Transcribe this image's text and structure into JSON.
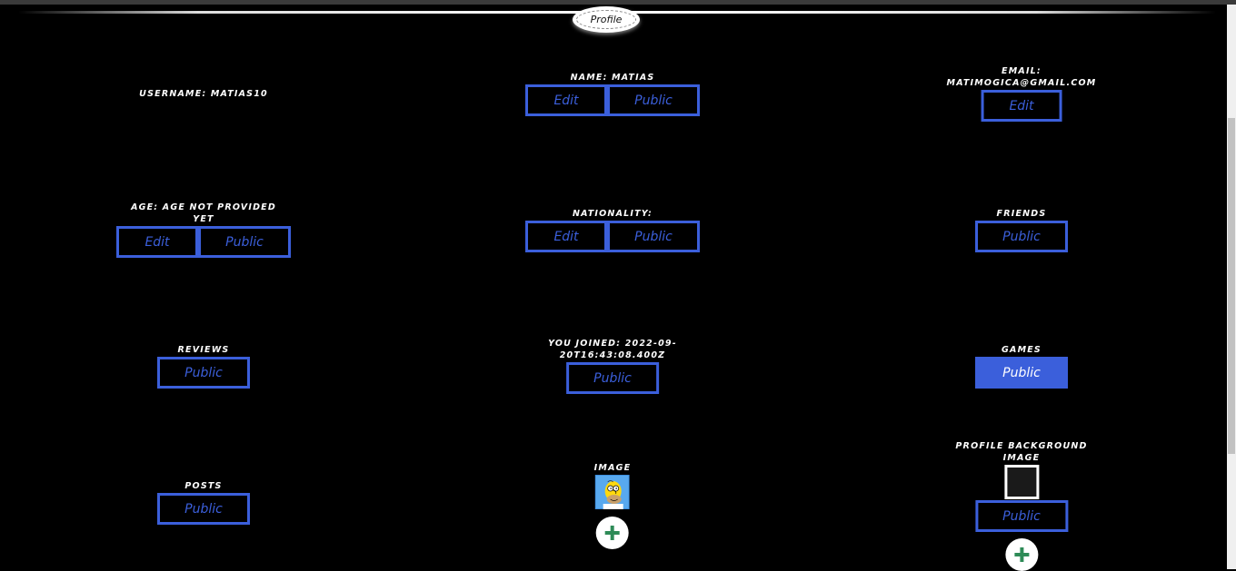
{
  "header": {
    "tab_label": "Profile"
  },
  "fields": {
    "username": {
      "label": "USERNAME: MATIAS10"
    },
    "name": {
      "label": "NAME: MATIAS",
      "edit": "Edit",
      "public": "Public"
    },
    "email": {
      "label_line1": "EMAIL:",
      "label_line2": "MATIMOGICA@GMAIL.COM",
      "edit": "Edit"
    },
    "age": {
      "label_line1": "AGE: AGE NOT PROVIDED",
      "label_line2": "YET",
      "edit": "Edit",
      "public": "Public"
    },
    "nationality": {
      "label": "NATIONALITY:",
      "edit": "Edit",
      "public": "Public"
    },
    "friends": {
      "label": "FRIENDS",
      "public": "Public"
    },
    "reviews": {
      "label": "REVIEWS",
      "public": "Public"
    },
    "joined": {
      "label_line1": "YOU JOINED: 2022-09-",
      "label_line2": "20T16:43:08.400Z",
      "public": "Public"
    },
    "games": {
      "label": "GAMES",
      "public": "Public",
      "active": true
    },
    "posts": {
      "label": "POSTS",
      "public": "Public"
    },
    "image": {
      "label": "IMAGE",
      "icon": "avatar-homer-image"
    },
    "background": {
      "label_line1": "PROFILE BACKGROUND",
      "label_line2": "IMAGE",
      "public": "Public",
      "swatch_color": "#1a1a1a"
    }
  },
  "colors": {
    "accent": "#3b5fdb",
    "background": "#000000",
    "add_icon": "#2e8b57"
  }
}
